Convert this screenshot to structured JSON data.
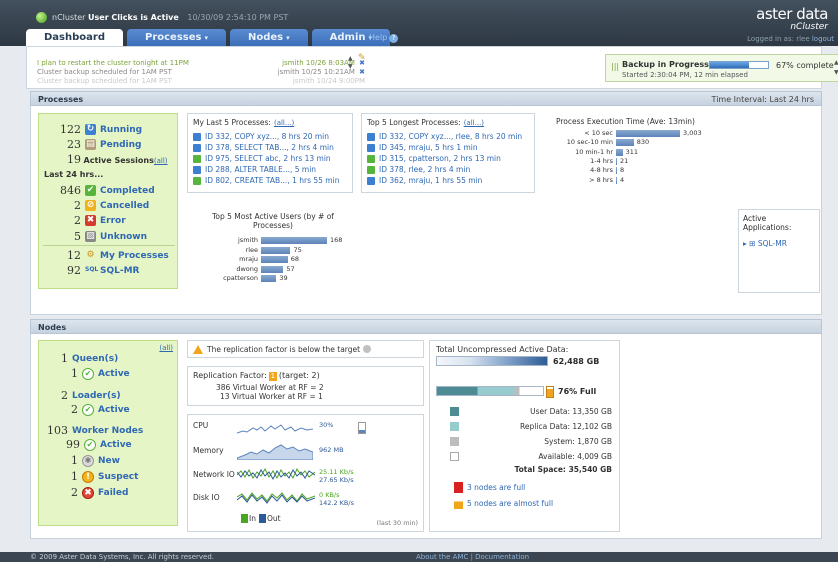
{
  "header": {
    "cluster_status_prefix": "nCluster",
    "cluster_status_bold": "User Clicks is Active",
    "cluster_time": "10/30/09 2:54:10 PM PST",
    "logo_a": "aster",
    "logo_b": "data",
    "product": "nCluster",
    "login_text": "Logged in as: rlee",
    "logout": "logout",
    "help": "Help",
    "help_icon": "?"
  },
  "tabs": [
    {
      "label": "Dashboard",
      "caret": ""
    },
    {
      "label": "Processes",
      "caret": "▾"
    },
    {
      "label": "Nodes",
      "caret": "▾"
    },
    {
      "label": "Admin",
      "caret": "▾"
    }
  ],
  "messages": [
    {
      "text": "I plan to restart the cluster tonight at 11PM",
      "meta": "jsmith 10/26 8:03AM"
    },
    {
      "text": "Cluster backup scheduled for 1AM PST",
      "meta": "jsmith 10/25 10:21AM"
    },
    {
      "text": "Cluster backup scheduled for 1AM PST",
      "meta": "jsmith 10/24 9:00PM"
    }
  ],
  "backup": {
    "title": "Backup in Progress",
    "subtitle": "Started 2:30:04 PM, 12 min elapsed",
    "progress": 0.67,
    "pct_label": "67% complete"
  },
  "processes_section": {
    "title": "Processes",
    "interval": "Time Interval: Last 24 hrs"
  },
  "proc_summary": {
    "running_n": "122",
    "running_label": "Running",
    "pending_n": "23",
    "pending_label": "Pending",
    "sessions_n": "19",
    "sessions_label": "Active Sessions",
    "sessions_all": "(all)",
    "last24": "Last 24 hrs...",
    "completed_n": "846",
    "completed_label": "Completed",
    "cancelled_n": "2",
    "cancelled_label": "Cancelled",
    "error_n": "2",
    "error_label": "Error",
    "unknown_n": "5",
    "unknown_label": "Unknown",
    "myproc_n": "12",
    "myproc_label": "My Processes",
    "sqlmr_n": "92",
    "sqlmr_label": "SQL-MR"
  },
  "last5": {
    "title": "My Last 5 Processes:",
    "all": "(all...)",
    "items": [
      {
        "text": "ID 332, COPY xyz..., 8 hrs 20 min",
        "status": "running"
      },
      {
        "text": "ID 378, SELECT TAB..., 2 hrs 4 min",
        "status": "running"
      },
      {
        "text": "ID 975, SELECT abc, 2 hrs 13 min",
        "status": "done"
      },
      {
        "text": "ID 288, ALTER TABLE..., 5 min",
        "status": "running"
      },
      {
        "text": "ID 802, CREATE TAB..., 1 hrs 55 min",
        "status": "done"
      }
    ]
  },
  "longest5": {
    "title": "Top 5 Longest Processes:",
    "all": "(all...)",
    "items": [
      {
        "text": "ID 332, COPY xyz..., rlee, 8 hrs 20 min",
        "status": "running"
      },
      {
        "text": "ID 345, mraju, 5 hrs 1 min",
        "status": "running"
      },
      {
        "text": "ID 315, cpatterson, 2 hrs 13 min",
        "status": "done"
      },
      {
        "text": "ID 378, rlee, 2 hrs 4 min",
        "status": "done"
      },
      {
        "text": "ID 362, mraju, 1 hrs 55 min",
        "status": "running"
      }
    ]
  },
  "apps": {
    "title": "Active Applications:",
    "items": [
      "SQL-MR"
    ]
  },
  "chart_data": [
    {
      "type": "bar",
      "orientation": "horizontal",
      "title": "Process Execution Time (Ave: 13min)",
      "categories": [
        "< 10 sec",
        "10 sec-10 min",
        "10 min-1 hr",
        "1-4 hrs",
        "4-8 hrs",
        "> 8 hrs"
      ],
      "values": [
        3003,
        830,
        311,
        21,
        8,
        4
      ],
      "value_labels": [
        "3,003",
        "830",
        "311",
        "21",
        "8",
        "4"
      ]
    },
    {
      "type": "bar",
      "orientation": "horizontal",
      "title": "Top 5 Most Active Users (by # of Processes)",
      "categories": [
        "jsmith",
        "rlee",
        "mraju",
        "dwong",
        "cpatterson"
      ],
      "values": [
        168,
        75,
        68,
        57,
        39
      ],
      "value_labels": [
        "168",
        "75",
        "68",
        "57",
        "39"
      ]
    }
  ],
  "nodes_section": {
    "title": "Nodes"
  },
  "node_summary": {
    "all": "(all)",
    "queen_n": "1",
    "queen_label": "Queen(s)",
    "queen_active_n": "1",
    "queen_active_label": "Active",
    "loader_n": "2",
    "loader_label": "Loader(s)",
    "loader_active_n": "2",
    "loader_active_label": "Active",
    "worker_n": "103",
    "worker_label": "Worker Nodes",
    "worker_active_n": "99",
    "worker_active_label": "Active",
    "new_n": "1",
    "new_label": "New",
    "suspect_n": "1",
    "suspect_label": "Suspect",
    "failed_n": "2",
    "failed_label": "Failed"
  },
  "replication": {
    "warning": "The replication factor is below the target",
    "rf_label": "Replication Factor:",
    "rf_value": "1",
    "rf_target": "(target: 2)",
    "line1": "386 Virtual Worker at RF = 2",
    "line2": "13 Virtual Worker at RF = 1"
  },
  "resources": {
    "cpu_label": "CPU",
    "cpu_val": "30%",
    "cpu_level": 0.3,
    "mem_label": "Memory",
    "mem_val": "962 MB",
    "net_label": "Network IO",
    "net_in": "25.11 Kb/s",
    "net_out": "27.65 Kb/s",
    "disk_label": "Disk IO",
    "disk_in": "0 KB/s",
    "disk_out": "142.2 KB/s",
    "legend_in": "In",
    "legend_out": "Out",
    "footer": "(last 30 min)"
  },
  "data": {
    "title": "Total Uncompressed Active Data:",
    "total_active": "62,488 GB",
    "full_label": "76% Full",
    "user_label": "User Data:",
    "user_val": "13,350 GB",
    "replica_label": "Replica Data:",
    "replica_val": "12,102 GB",
    "system_label": "System:",
    "system_val": "1,870 GB",
    "available_label": "Available:",
    "available_val": "4,009 GB",
    "total_label": "Total Space:",
    "total_val": "35,540 GB",
    "alert_full": "3 nodes are full",
    "alert_almost": "5 nodes are almost full"
  },
  "colors": {
    "user": "#4d8c95",
    "replica": "#96cccd",
    "system": "#bdbdbd",
    "available": "#ffffff",
    "red": "#d92020",
    "orange": "#f0a51a"
  },
  "footer": {
    "left": "© 2009 Aster Data Systems, Inc. All rights reserved.",
    "mid": "About the AMC | Documentation"
  }
}
